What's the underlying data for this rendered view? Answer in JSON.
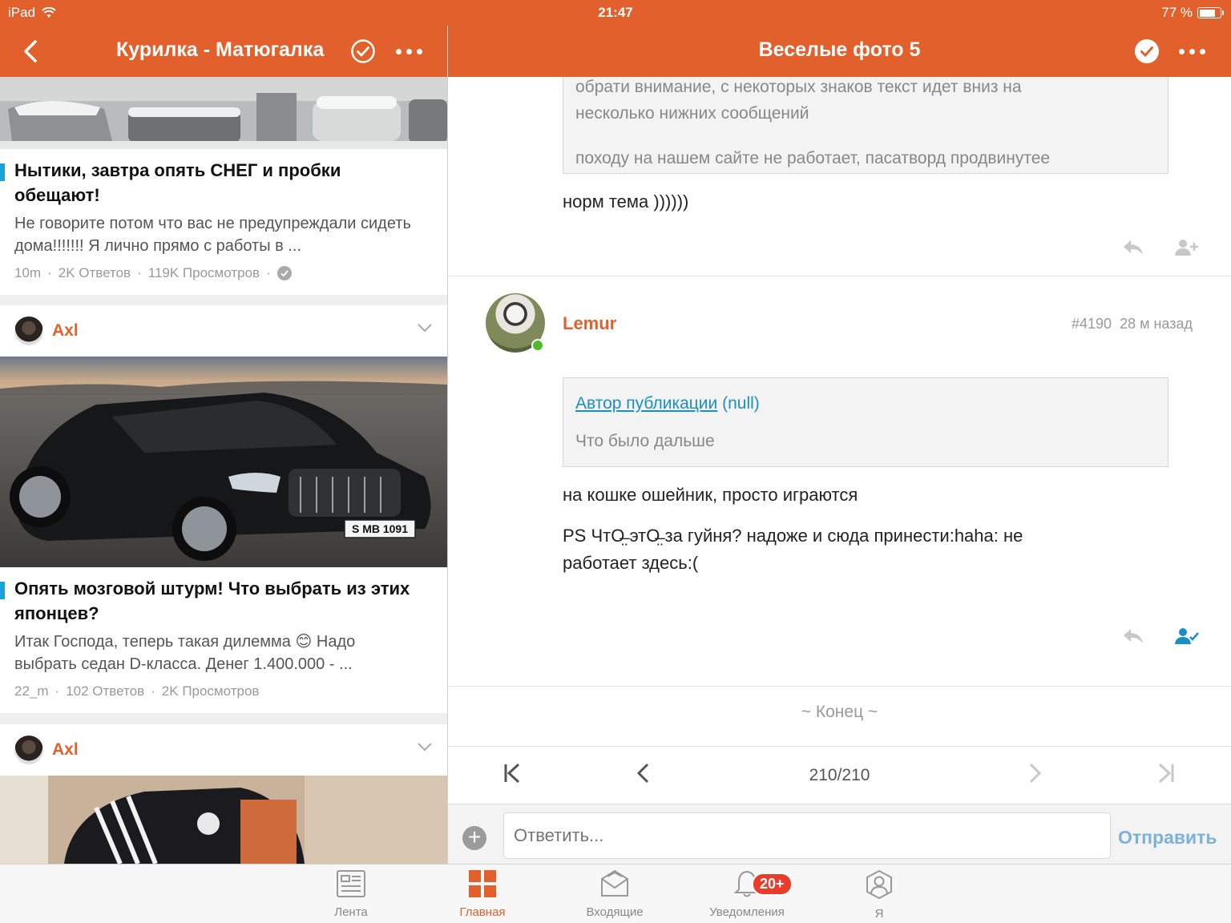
{
  "status_bar": {
    "device": "iPad",
    "time": "21:47",
    "battery_text": "77 %",
    "battery_level": 0.77
  },
  "left_header": {
    "title": "Курилка - Матюгалка"
  },
  "right_header": {
    "title": "Веселые фото 5"
  },
  "feed": {
    "posts": [
      {
        "title": "Нытики, завтра опять СНЕГ и пробки обещают!",
        "excerpt": "Не говорите потом что вас не предупреждали сидеть дома!!!!!!! Я лично прямо с работы в ...",
        "meta_time": "10m",
        "meta_replies": "2K Ответов",
        "meta_views": "119K Просмотров"
      },
      {
        "author": "Axl",
        "title": "Опять мозговой штурм! Что выбрать из этих японцев?",
        "excerpt_line1": "Итак Господа, теперь такая дилемма",
        "excerpt_emoji": "😊",
        "excerpt_line1b": "Надо",
        "excerpt_line2": "выбрать седан D-класса. Денег 1.400.000 - ...",
        "meta_time": "22_m",
        "meta_replies": "102 Ответов",
        "meta_views": "2K Просмотров",
        "plate": "S MB 1091"
      },
      {
        "author": "Axl"
      }
    ]
  },
  "thread": {
    "prev_quote": {
      "line1": "обрати внимание, с некоторых знаков текст идет вниз на",
      "line2": "несколько нижних сообщений",
      "line3": "походу на нашем сайте не работает, пасатворд продвинутее"
    },
    "prev_message": "норм тема ))))))",
    "post": {
      "user": "Lemur",
      "number": "#4190",
      "time_ago": "28 м назад",
      "quote_link": "Автор публикации",
      "quote_null": "(null)",
      "quote_text": "Что было дальше",
      "line1": "на кошке ошейник, просто играются",
      "line2_a": "PS ЧтО̶̤ ",
      "line2_b": "этО̶̤",
      "line2_c": " за гуйня? надоже и сюда принести:haha: не",
      "line3": "работает здесь:("
    },
    "end_label": "~ Конец ~",
    "pagination": "210/210",
    "reply_placeholder": "Ответить...",
    "send_label": "Отправить"
  },
  "tabbar": {
    "tabs": [
      {
        "label": "Лента",
        "icon": "feed-icon"
      },
      {
        "label": "Главная",
        "icon": "home-grid-icon"
      },
      {
        "label": "Входящие",
        "icon": "inbox-icon"
      },
      {
        "label": "Уведомления",
        "icon": "bell-icon"
      },
      {
        "label": "Я",
        "icon": "profile-icon"
      }
    ],
    "notifications_badge": "20+"
  },
  "colors": {
    "brand_orange": "#e2602c",
    "accent_blue": "#1aa2d8",
    "online_green": "#4cbb2a",
    "badge_red": "#e83d2a"
  }
}
